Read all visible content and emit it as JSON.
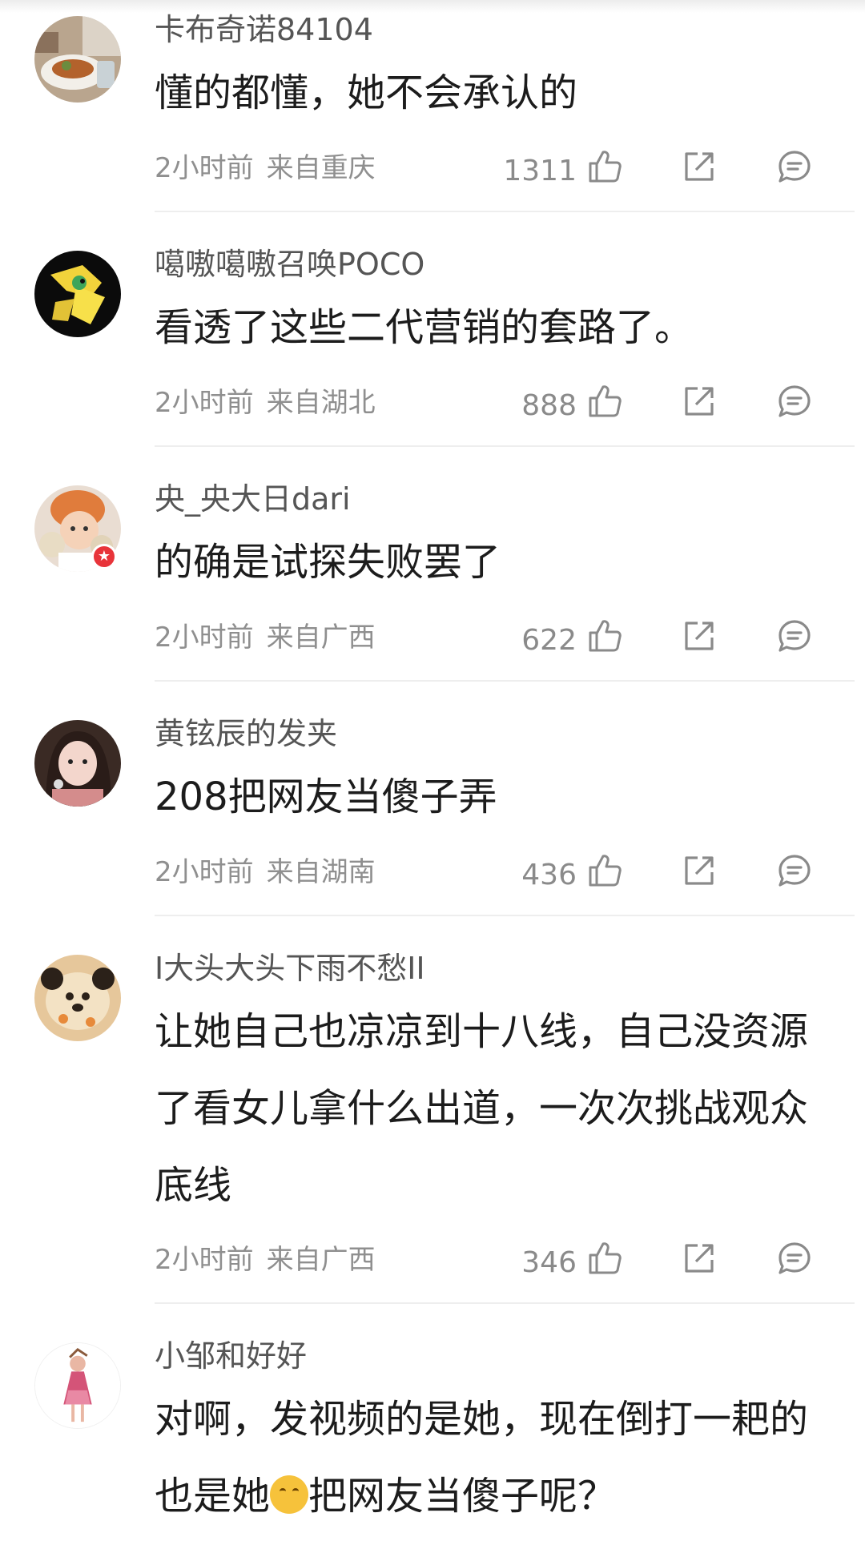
{
  "comments": [
    {
      "username": "卡布奇诺84104",
      "text": "懂的都懂，她不会承认的",
      "time": "2小时前",
      "location": "来自重庆",
      "likes": "1311"
    },
    {
      "username": "噶嗷噶嗷召唤POCO",
      "text": "看透了这些二代营销的套路了。",
      "time": "2小时前",
      "location": "来自湖北",
      "likes": "888"
    },
    {
      "username": "央_央大日dari",
      "text": "的确是试探失败罢了",
      "time": "2小时前",
      "location": "来自广西",
      "likes": "622"
    },
    {
      "username": "黄铉辰的发夹",
      "text": "208把网友当傻子弄",
      "time": "2小时前",
      "location": "来自湖南",
      "likes": "436"
    },
    {
      "username": "I大头大头下雨不愁II",
      "text": "让她自己也凉凉到十八线，自己没资源了看女儿拿什么出道，一次次挑战观众底线",
      "time": "2小时前",
      "location": "来自广西",
      "likes": "346"
    },
    {
      "username": "小邹和好好",
      "text_part1": "对啊，发视频的是她，现在倒打一耙的也是她",
      "emoji": "smile-emoji",
      "text_part2": "把网友当傻子呢？"
    }
  ],
  "icons": {
    "like": "thumbs-up-icon",
    "share": "share-icon",
    "reply": "comment-icon"
  },
  "colors": {
    "text": "#1c1c1c",
    "username": "#555555",
    "meta": "#8f8f8f",
    "icon": "#8a8a8a",
    "divider": "#eeeeee",
    "badge": "#e8343a"
  }
}
